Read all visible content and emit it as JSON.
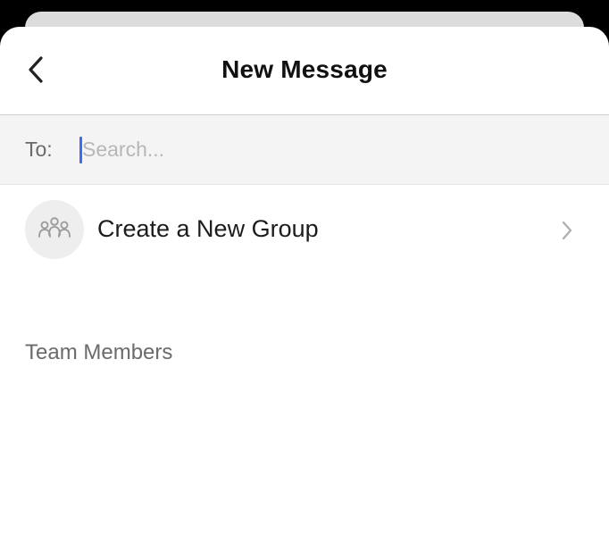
{
  "header": {
    "title": "New Message",
    "back_icon": "chevron-left-icon"
  },
  "recipient": {
    "label": "To:",
    "placeholder": "Search...",
    "value": ""
  },
  "create_group": {
    "label": "Create a New Group",
    "icon": "group-icon",
    "chevron_icon": "chevron-right-icon"
  },
  "sections": {
    "team_members_title": "Team Members"
  },
  "colors": {
    "caret": "#3d6bf5",
    "background": "#ffffff",
    "search_bar": "#f4f4f4"
  }
}
